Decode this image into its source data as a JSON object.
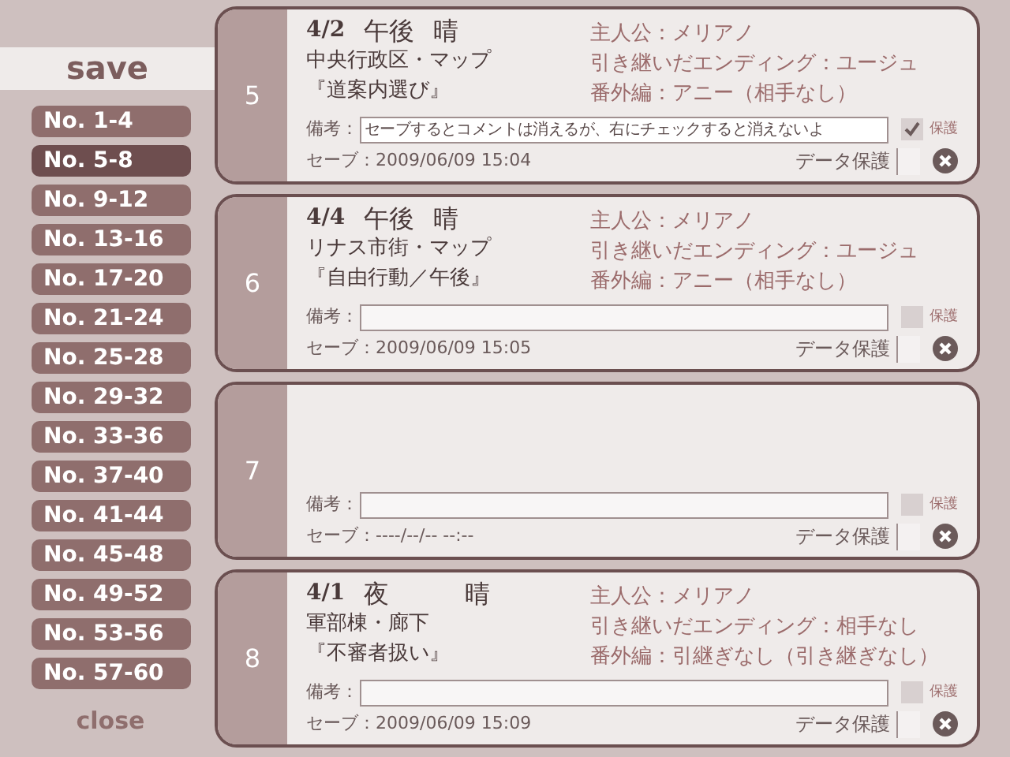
{
  "sidebar": {
    "title": "save",
    "pages": [
      {
        "label": "No. 1-4",
        "selected": false
      },
      {
        "label": "No. 5-8",
        "selected": true
      },
      {
        "label": "No. 9-12",
        "selected": false
      },
      {
        "label": "No. 13-16",
        "selected": false
      },
      {
        "label": "No. 17-20",
        "selected": false
      },
      {
        "label": "No. 21-24",
        "selected": false
      },
      {
        "label": "No. 25-28",
        "selected": false
      },
      {
        "label": "No. 29-32",
        "selected": false
      },
      {
        "label": "No. 33-36",
        "selected": false
      },
      {
        "label": "No. 37-40",
        "selected": false
      },
      {
        "label": "No. 41-44",
        "selected": false
      },
      {
        "label": "No. 45-48",
        "selected": false
      },
      {
        "label": "No. 49-52",
        "selected": false
      },
      {
        "label": "No. 53-56",
        "selected": false
      },
      {
        "label": "No. 57-60",
        "selected": false
      }
    ],
    "close": "close"
  },
  "slots": [
    {
      "number": "5",
      "kind": "filled",
      "date": "4/2",
      "time": "午後",
      "weather": "晴",
      "location": "中央行政区・マップ",
      "event": "『道案内選び』",
      "info": [
        "主人公：メリアノ",
        "引き継いだエンディング：ユージュ",
        "番外編：アニー（相手なし）"
      ],
      "memo_label": "備考：",
      "memo": "セーブするとコメントは消えるが、右にチェックすると消えないよ",
      "memo_protect": {
        "checked": true,
        "label": "保護"
      },
      "save_label": "セーブ：",
      "saved_at": "2009/06/09 15:04",
      "data_protect": {
        "label": "データ保護",
        "checked": false
      }
    },
    {
      "number": "6",
      "kind": "filled",
      "date": "4/4",
      "time": "午後",
      "weather": "晴",
      "location": "リナス市街・マップ",
      "event": "『自由行動／午後』",
      "info": [
        "主人公：メリアノ",
        "引き継いだエンディング：ユージュ",
        "番外編：アニー（相手なし）"
      ],
      "memo_label": "備考：",
      "memo_protect": {
        "checked": false,
        "label": "保護"
      },
      "save_label": "セーブ：",
      "saved_at": "2009/06/09 15:05",
      "data_protect": {
        "label": "データ保護",
        "checked": false
      }
    },
    {
      "number": "7",
      "kind": "empty",
      "memo_label": "備考：",
      "memo_protect": {
        "checked": false,
        "label": "保護"
      },
      "save_label": "セーブ：",
      "saved_at": "----/--/-- --:--",
      "data_protect": {
        "label": "データ保護",
        "checked": false
      }
    },
    {
      "number": "8",
      "kind": "filled",
      "date": "4/1",
      "time": "夜",
      "weather": "晴",
      "location": "軍部棟・廊下",
      "event": "『不審者扱い』",
      "info": [
        "主人公：メリアノ",
        "引き継いだエンディング：相手なし",
        "番外編：引継ぎなし（引き継ぎなし）"
      ],
      "memo_label": "備考：",
      "memo_protect": {
        "checked": false,
        "label": "保護"
      },
      "save_label": "セーブ：",
      "saved_at": "2009/06/09 15:09",
      "data_protect": {
        "label": "データ保護",
        "checked": false
      }
    }
  ]
}
